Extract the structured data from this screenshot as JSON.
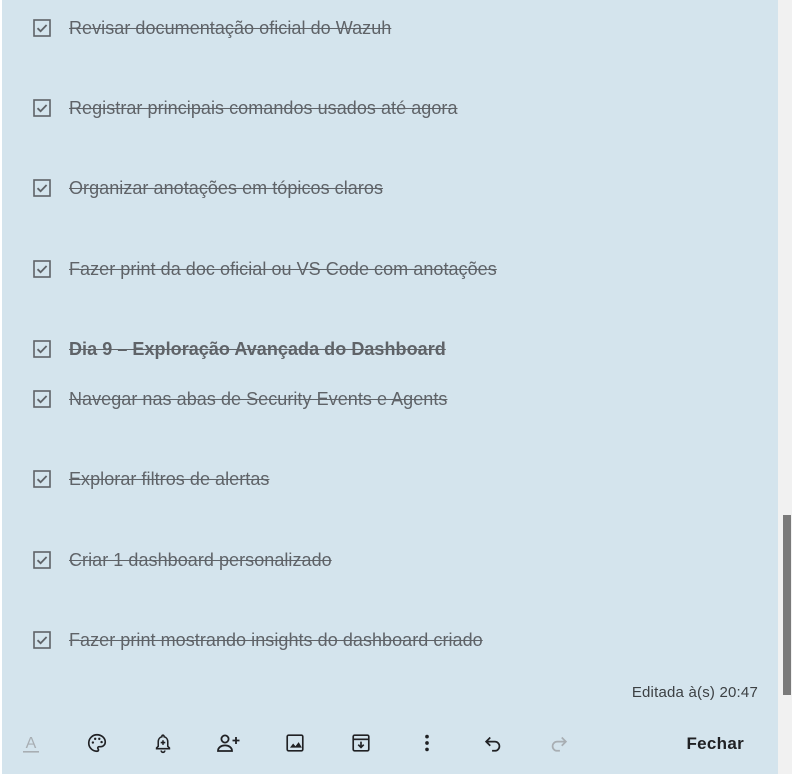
{
  "checklist": {
    "items": [
      {
        "label": "Revisar documentação oficial do Wazuh",
        "checked": true,
        "bold": false
      },
      {
        "label": "Registrar principais comandos usados até agora",
        "checked": true,
        "bold": false
      },
      {
        "label": "Organizar anotações em tópicos claros",
        "checked": true,
        "bold": false
      },
      {
        "label": "Fazer print da doc oficial ou VS Code com anotações",
        "checked": true,
        "bold": false
      },
      {
        "label": "Dia 9 – Exploração Avançada do Dashboard",
        "checked": true,
        "bold": true
      },
      {
        "label": "Navegar nas abas de Security Events e Agents",
        "checked": true,
        "bold": false
      },
      {
        "label": "Explorar filtros de alertas",
        "checked": true,
        "bold": false
      },
      {
        "label": "Criar 1 dashboard personalizado",
        "checked": true,
        "bold": false
      },
      {
        "label": "Fazer print mostrando insights do dashboard criado",
        "checked": true,
        "bold": false
      }
    ]
  },
  "note": {
    "edited_text": "Editada à(s) 20:47",
    "background_color": "#d4e4ed"
  },
  "toolbar": {
    "icons": [
      "text-format-icon",
      "palette-icon",
      "reminder-bell-icon",
      "collaborator-icon",
      "image-icon",
      "archive-icon",
      "more-vert-icon",
      "undo-icon",
      "redo-icon"
    ],
    "close_label": "Fechar"
  }
}
